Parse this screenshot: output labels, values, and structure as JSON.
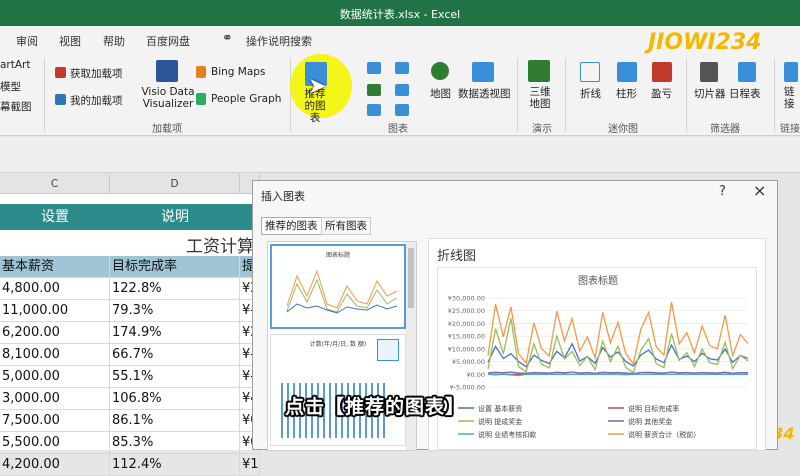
{
  "window": {
    "title": "数据统计表.xlsx  -  Excel"
  },
  "tabs": [
    "审阅",
    "视图",
    "帮助",
    "百度网盘"
  ],
  "tell_me": "操作说明搜索",
  "ribbon": {
    "left_partial": [
      "artArt",
      "模型",
      "幕截图"
    ],
    "addins": {
      "get": "获取加载项",
      "mine": "我的加载项",
      "visio": "Visio Data Visualizer",
      "bing": "Bing Maps",
      "people": "People Graph",
      "group": "加载项"
    },
    "recommended_charts": "推荐的图表",
    "charts": {
      "map": "地图",
      "pivot": "数据透视图",
      "group": "图表"
    },
    "tours": {
      "map3d": "三维地图",
      "group": "演示"
    },
    "sparklines": {
      "line": "折线",
      "column": "柱形",
      "winloss": "盈亏",
      "group": "迷你图"
    },
    "filters": {
      "slicer": "切片器",
      "timeline": "日程表",
      "group": "筛选器"
    },
    "links": {
      "link": "链接",
      "group": "链接"
    }
  },
  "sheet": {
    "columns": [
      "C",
      "D"
    ],
    "header_labels": [
      "设置",
      "说明"
    ],
    "title_partial": "工资计算",
    "col_headers": [
      "基本薪资",
      "目标完成率",
      "提"
    ],
    "rows": [
      [
        "4,800.00",
        "122.8%",
        "¥2"
      ],
      [
        "11,000.00",
        "79.3%",
        "¥-"
      ],
      [
        "6,200.00",
        "174.9%",
        "¥2"
      ],
      [
        "8,100.00",
        "66.7%",
        "¥-"
      ],
      [
        "5,000.00",
        "55.1%",
        "¥-"
      ],
      [
        "3,000.00",
        "106.8%",
        "¥4"
      ],
      [
        "7,500.00",
        "86.1%",
        "¥0"
      ],
      [
        "5,500.00",
        "85.3%",
        "¥0"
      ],
      [
        "4,200.00",
        "112.4%",
        "¥1"
      ]
    ]
  },
  "dialog": {
    "title": "插入图表",
    "help": "?",
    "close": "×",
    "tabs": [
      "推荐的图表",
      "所有图表"
    ],
    "thumb_title": "图表标题",
    "thumb2_title": "计数(年/月/日, 数 额)",
    "chart_type_name": "折线图",
    "preview_title": "图表标题"
  },
  "subtitle": "点击【推荐的图表】",
  "watermark": "JIOWI234",
  "chart_data": {
    "type": "line",
    "title": "图表标题",
    "ylim": [
      -5000,
      30000
    ],
    "y_ticks": [
      "¥30,000.00",
      "¥25,000.00",
      "¥20,000.00",
      "¥15,000.00",
      "¥10,000.00",
      "¥5,000.00",
      "¥0.00",
      "¥-5,000.00"
    ],
    "legend": [
      {
        "name": "设置 基本薪资",
        "color": "#4472c4"
      },
      {
        "name": "说明 目标完成率",
        "color": "#c0504d"
      },
      {
        "name": "说明 提成奖金",
        "color": "#9bbb59"
      },
      {
        "name": "说明 其他奖金",
        "color": "#8064a2"
      },
      {
        "name": "说明 业绩考核扣款",
        "color": "#4bacc6"
      },
      {
        "name": "说明 薪资合计（税前）",
        "color": "#f79646"
      }
    ],
    "series": [
      {
        "name": "设置 基本薪资",
        "color": "#4472c4",
        "values": [
          4800,
          11000,
          6200,
          8100,
          5000,
          3000,
          7500,
          5500,
          4200,
          9000,
          6500,
          12000,
          5200,
          7000,
          4300,
          10500,
          6800,
          8800,
          5100,
          3200,
          7600,
          9500,
          6000,
          4500,
          11500,
          5800,
          7200,
          4900,
          8300,
          6100,
          5600,
          9900,
          4700,
          7400,
          6300
        ]
      },
      {
        "name": "说明 目标完成率",
        "color": "#c0504d",
        "values": [
          1,
          1,
          2,
          1,
          1,
          1,
          1,
          1,
          1,
          1,
          1,
          1,
          1,
          1,
          1,
          1,
          1,
          1,
          1,
          1,
          1,
          1,
          1,
          1,
          1,
          1,
          1,
          1,
          1,
          1,
          1,
          1,
          1,
          1,
          1
        ]
      },
      {
        "name": "说明 提成奖金",
        "color": "#9bbb59",
        "values": [
          2000,
          18000,
          8000,
          22000,
          3000,
          1000,
          12000,
          4000,
          2500,
          15000,
          6000,
          9000,
          3500,
          7000,
          1800,
          13000,
          5000,
          11000,
          2800,
          600,
          9500,
          14000,
          4200,
          2600,
          16000,
          5500,
          8500,
          3000,
          10000,
          4500,
          3900,
          12500,
          2200,
          7500,
          5200
        ]
      },
      {
        "name": "说明 其他奖金",
        "color": "#8064a2",
        "values": [
          500,
          800,
          600,
          900,
          500,
          400,
          700,
          600,
          500,
          800,
          600,
          900,
          500,
          700,
          400,
          800,
          600,
          700,
          500,
          300,
          700,
          800,
          600,
          500,
          900,
          600,
          700,
          500,
          700,
          600,
          500,
          800,
          400,
          700,
          600
        ]
      },
      {
        "name": "说明 业绩考核扣款",
        "color": "#4bacc6",
        "values": [
          0,
          -200,
          0,
          -300,
          -500,
          0,
          0,
          0,
          0,
          0,
          0,
          0,
          -100,
          0,
          0,
          0,
          0,
          0,
          -200,
          0,
          0,
          0,
          0,
          0,
          0,
          0,
          0,
          0,
          0,
          0,
          0,
          0,
          0,
          0,
          0
        ]
      },
      {
        "name": "说明 薪资合计（税前）",
        "color": "#f79646",
        "values": [
          7300,
          27600,
          14800,
          26500,
          8000,
          4400,
          20200,
          10100,
          7200,
          24800,
          13100,
          21900,
          9100,
          14700,
          6500,
          24300,
          12400,
          20500,
          8200,
          4100,
          17800,
          24300,
          10800,
          7600,
          28400,
          11900,
          16400,
          8400,
          19000,
          11200,
          10000,
          23200,
          7300,
          15600,
          12100
        ]
      }
    ]
  }
}
